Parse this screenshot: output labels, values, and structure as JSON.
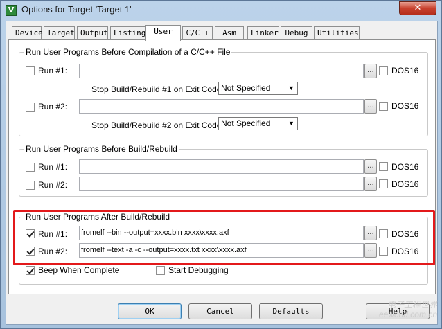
{
  "window": {
    "title": "Options for Target 'Target 1'",
    "close_glyph": "✕"
  },
  "tabs": [
    {
      "label": "Device"
    },
    {
      "label": "Target"
    },
    {
      "label": "Output"
    },
    {
      "label": "Listing"
    },
    {
      "label": "User",
      "active": true
    },
    {
      "label": "C/C++"
    },
    {
      "label": "Asm"
    },
    {
      "label": "Linker"
    },
    {
      "label": "Debug"
    },
    {
      "label": "Utilities"
    }
  ],
  "before_compile": {
    "title": "Run User Programs Before Compilation of a C/C++ File",
    "run1": {
      "label": "Run #1:",
      "checked": false,
      "value": "",
      "browse": "...",
      "dos16": "DOS16"
    },
    "stop1": {
      "label": "Stop Build/Rebuild #1 on Exit Code:",
      "value": "Not Specified"
    },
    "run2": {
      "label": "Run #2:",
      "checked": false,
      "value": "",
      "browse": "...",
      "dos16": "DOS16"
    },
    "stop2": {
      "label": "Stop Build/Rebuild #2 on Exit Code:",
      "value": "Not Specified"
    }
  },
  "before_build": {
    "title": "Run User Programs Before Build/Rebuild",
    "run1": {
      "label": "Run #1:",
      "checked": false,
      "value": "",
      "browse": "...",
      "dos16": "DOS16"
    },
    "run2": {
      "label": "Run #2:",
      "checked": false,
      "value": "",
      "browse": "...",
      "dos16": "DOS16"
    }
  },
  "after_build": {
    "title": "Run User Programs After Build/Rebuild",
    "run1": {
      "label": "Run #1:",
      "checked": true,
      "value": "fromelf --bin --output=xxxx.bin xxxx\\xxxx.axf",
      "browse": "...",
      "dos16": "DOS16"
    },
    "run2": {
      "label": "Run #2:",
      "checked": true,
      "value": "fromelf --text -a -c --output=xxxx.txt xxxx\\xxxx.axf",
      "browse": "...",
      "dos16": "DOS16"
    }
  },
  "beep": {
    "label": "Beep When Complete",
    "checked": true
  },
  "start_debug": {
    "label": "Start Debugging",
    "checked": false
  },
  "buttons": {
    "ok": "OK",
    "cancel": "Cancel",
    "defaults": "Defaults",
    "help": "Help"
  },
  "watermark": {
    "line1": "电子工程世界",
    "line2": "eeworld.com.cn"
  },
  "colors": {
    "highlight": "#e3191b",
    "titlebar": "#bcd3ea"
  }
}
